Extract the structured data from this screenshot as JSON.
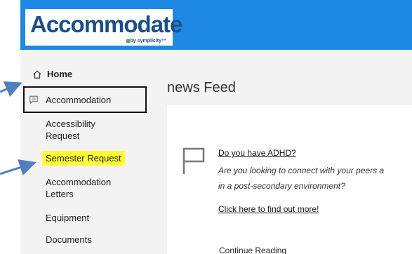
{
  "logo": {
    "brand": "Accommodate",
    "byline": "by symplicity™"
  },
  "sidebar": {
    "home_label": "Home",
    "accommodation_label": "Accommodation",
    "sub_items": [
      {
        "label_line1": "Accessibility",
        "label_line2": "Request"
      },
      {
        "label_line1": "Semester Request",
        "label_line2": ""
      },
      {
        "label_line1": "Accommodation",
        "label_line2": "Letters"
      },
      {
        "label_line1": "Equipment",
        "label_line2": ""
      },
      {
        "label_line1": "Documents",
        "label_line2": ""
      }
    ]
  },
  "main": {
    "title": "news Feed",
    "post": {
      "headline": "Do you have ADHD?",
      "body_line1": "Are you looking to connect with your peers a",
      "body_line2": "in a post-secondary environment?",
      "link": "Click here to find out more!",
      "continue": "Continue Reading"
    }
  },
  "colors": {
    "topbar": "#1e88e5",
    "highlight": "#ffff33",
    "annotation_arrow": "#4f7fc0"
  },
  "icons": [
    "home-icon",
    "chat-icon",
    "flag-icon"
  ]
}
